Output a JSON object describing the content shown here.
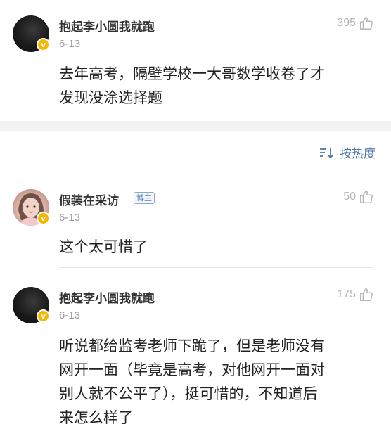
{
  "comments": [
    {
      "username": "抱起李小圆我就跑",
      "date": "6-13",
      "likes": "395",
      "text_lines": [
        "去年高考，隔壁学校一大哥数学收卷了才",
        "发现没涂选择题"
      ]
    },
    {
      "username": "假装在采访",
      "tag": "博主",
      "date": "6-13",
      "likes": "50",
      "text_lines": [
        "这个太可惜了"
      ]
    },
    {
      "username": "抱起李小圆我就跑",
      "date": "6-13",
      "likes": "175",
      "text_lines": [
        "听说都给监考老师下跪了，但是老师没有",
        "网开一面（毕竟是高考，对他网开一面对",
        "别人就不公平了），挺可惜的，不知道后",
        "来怎么样了"
      ]
    }
  ],
  "sort": {
    "label": "按热度"
  },
  "badge": {
    "symbol": "v",
    "color": "#f7b500"
  },
  "colors": {
    "link": "#4c76aa",
    "muted": "#999999"
  }
}
